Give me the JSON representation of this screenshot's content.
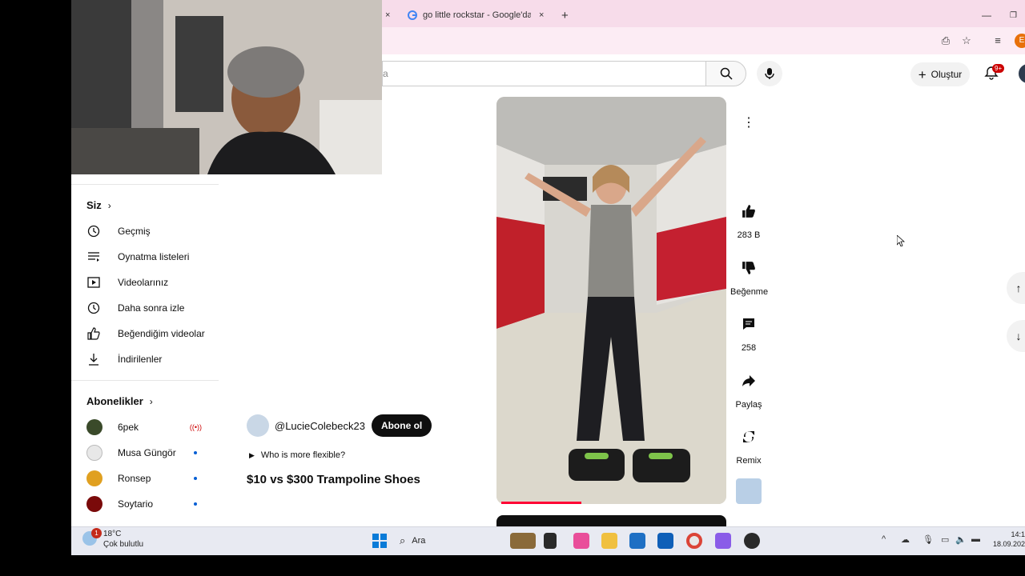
{
  "browser": {
    "tabs": [
      {
        "label": "go little rockstar - Google'da A",
        "icon": "google-icon"
      }
    ],
    "new_tab": "+",
    "close": "×"
  },
  "header": {
    "search_placeholder": "a",
    "create_label": "Oluştur",
    "notification_count": "9+"
  },
  "sidebar": {
    "you_section": "Siz",
    "you_items": [
      {
        "label": "Geçmiş",
        "icon": "history-icon"
      },
      {
        "label": "Oynatma listeleri",
        "icon": "playlist-icon"
      },
      {
        "label": "Videolarınız",
        "icon": "your-videos-icon"
      },
      {
        "label": "Daha sonra izle",
        "icon": "watch-later-icon"
      },
      {
        "label": "Beğendiğim videolar",
        "icon": "liked-icon"
      },
      {
        "label": "İndirilenler",
        "icon": "download-icon"
      }
    ],
    "subs_section": "Abonelikler",
    "subscriptions": [
      {
        "label": "6pek",
        "status": "live",
        "color": "#3a4a2a"
      },
      {
        "label": "Musa Güngör",
        "status": "new",
        "color": "#e8e8e8"
      },
      {
        "label": "Ronsep",
        "status": "new",
        "color": "#e0a020"
      },
      {
        "label": "Soytario",
        "status": "new",
        "color": "#7a0a0a"
      }
    ]
  },
  "video": {
    "channel": "@LucieColebeck23",
    "subscribe_label": "Abone ol",
    "description": "Who is more flexible?",
    "title": "$10 vs $300 Trampoline Shoes",
    "progress": 0.35
  },
  "actions": {
    "likes": "283 B",
    "dislike_label": "Beğenme",
    "comments": "258",
    "share_label": "Paylaş",
    "remix_label": "Remix"
  },
  "taskbar": {
    "temperature": "18°C",
    "weather": "Çok bulutlu",
    "weather_badge": "1",
    "search_label": "Ara",
    "time": "14:1",
    "date": "18.09.202"
  },
  "colors": {
    "accent_red": "#ff0033",
    "tab_bg": "#f7dcea"
  }
}
